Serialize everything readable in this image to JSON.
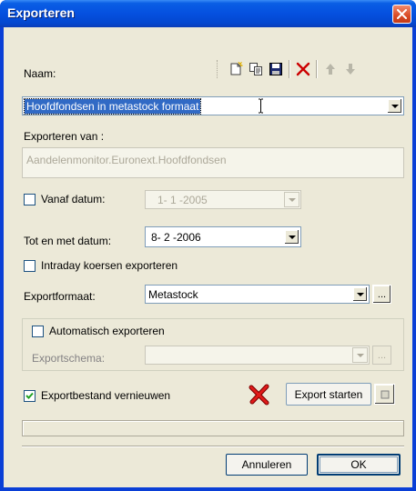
{
  "window": {
    "title": "Exporteren"
  },
  "naam": {
    "label": "Naam:",
    "value": "Hoofdfondsen in metastock formaat"
  },
  "toolbar": {
    "icons": [
      "new-icon",
      "copy-icon",
      "save-icon",
      "delete-icon",
      "up-arrow-icon",
      "down-arrow-icon"
    ],
    "delete_color": "#cc0000"
  },
  "exporteren_van": {
    "label": "Exporteren van :",
    "value": "Aandelenmonitor.Euronext.Hoofdfondsen"
  },
  "vanaf_datum": {
    "label": "Vanaf datum:",
    "value": "1- 1 -2005",
    "checked": false
  },
  "tot_datum": {
    "label": "Tot en met datum:",
    "value": "8- 2 -2006"
  },
  "intraday": {
    "label": "Intraday koersen exporteren",
    "checked": false
  },
  "exportformaat": {
    "label": "Exportformaat:",
    "value": "Metastock",
    "browse": "..."
  },
  "automatisch": {
    "label": "Automatisch exporteren",
    "checked": false
  },
  "exportschema": {
    "label": "Exportschema:",
    "value": "",
    "browse": "..."
  },
  "vernieuwen": {
    "label": "Exportbestand vernieuwen",
    "checked": true
  },
  "buttons": {
    "export_start": "Export starten",
    "cancel": "Annuleren",
    "ok": "OK"
  },
  "colors": {
    "title_bar": "#0550df",
    "selection": "#316ac5",
    "cancel_x": "#cc0000"
  }
}
